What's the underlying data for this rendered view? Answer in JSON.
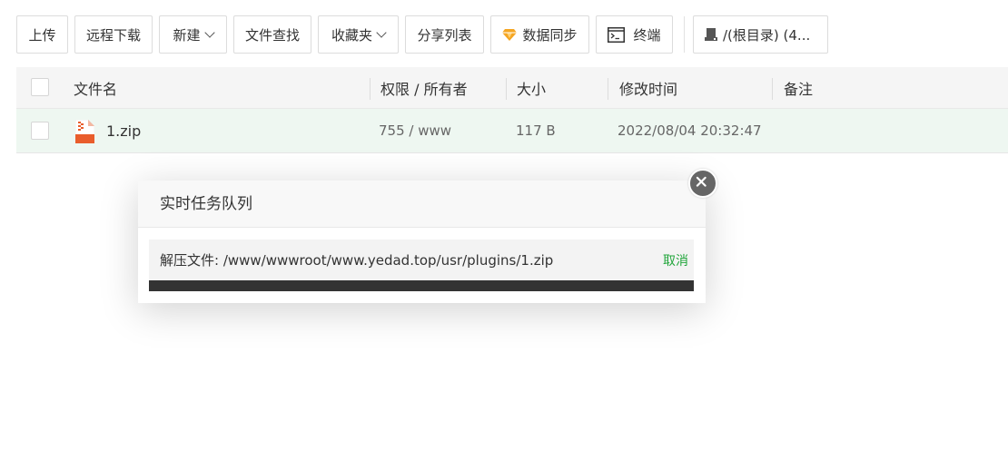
{
  "toolbar": {
    "upload": "上传",
    "remote_download": "远程下载",
    "new": "新建",
    "file_search": "文件查找",
    "favorites": "收藏夹",
    "share_list": "分享列表",
    "data_sync": "数据同步",
    "terminal": "终端",
    "path": "/(根目录) (4..."
  },
  "table": {
    "headers": {
      "name": "文件名",
      "permission_owner": "权限 / 所有者",
      "size": "大小",
      "modified": "修改时间",
      "note": "备注"
    },
    "rows": [
      {
        "name": "1.zip",
        "permission_owner": "755 / www",
        "size": "117 B",
        "modified": "2022/08/04 20:32:47",
        "note": ""
      }
    ]
  },
  "modal": {
    "title": "实时任务队列",
    "task_text": "解压文件: /www/wwwroot/www.yedad.top/usr/plugins/1.zip",
    "cancel_label": "取消",
    "progress": 1.0
  },
  "icons": {
    "dropdown": "chevron-down-icon",
    "data_sync": "diamond-icon",
    "terminal": "terminal-icon",
    "disk": "disk-icon",
    "file": "zip-file-icon",
    "close": "close-icon"
  },
  "colors": {
    "accent": "#20a53a",
    "diamond": "#f5a623",
    "zip": "#e95d2c",
    "row_selected": "#eef7f1",
    "progress": "#333333"
  }
}
